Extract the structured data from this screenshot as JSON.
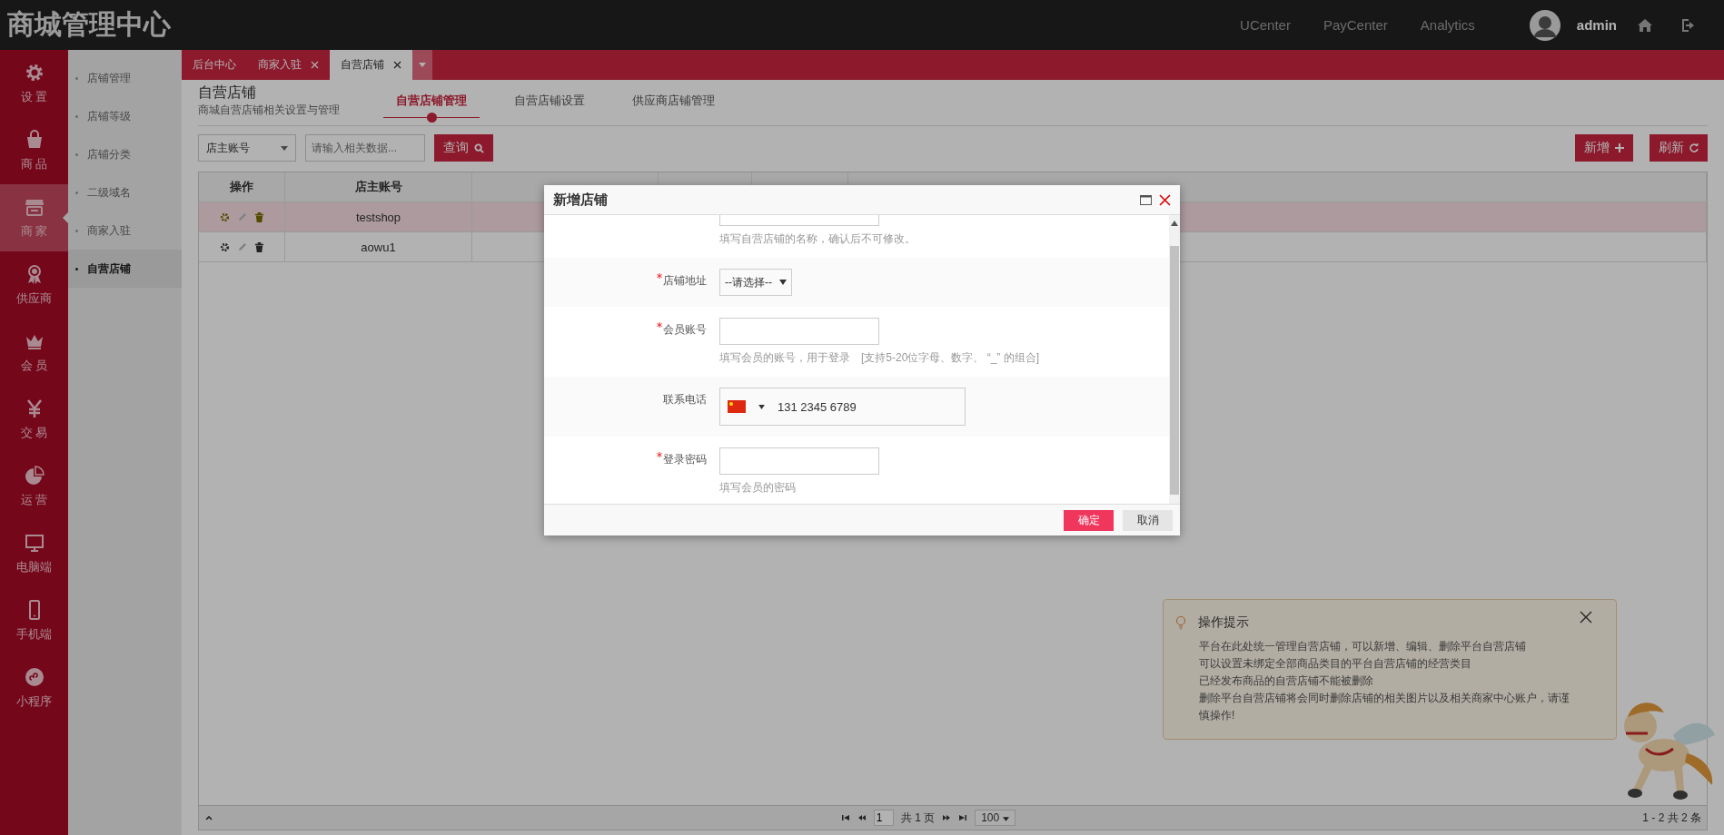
{
  "header": {
    "title": "商城管理中心",
    "links": [
      "UCenter",
      "PayCenter",
      "Analytics"
    ],
    "user": "admin"
  },
  "nav": [
    {
      "label": "设 置",
      "selected": false
    },
    {
      "label": "商 品",
      "selected": false
    },
    {
      "label": "商 家",
      "selected": true
    },
    {
      "label": "供应商",
      "selected": false
    },
    {
      "label": "会 员",
      "selected": false
    },
    {
      "label": "交 易",
      "selected": false
    },
    {
      "label": "运 营",
      "selected": false
    },
    {
      "label": "电脑端",
      "selected": false
    },
    {
      "label": "手机端",
      "selected": false
    },
    {
      "label": "小程序",
      "selected": false
    }
  ],
  "subnav": [
    {
      "label": "店铺管理",
      "selected": false
    },
    {
      "label": "店铺等级",
      "selected": false
    },
    {
      "label": "店铺分类",
      "selected": false
    },
    {
      "label": "二级域名",
      "selected": false
    },
    {
      "label": "商家入驻",
      "selected": false
    },
    {
      "label": "自营店铺",
      "selected": true
    }
  ],
  "tabs": [
    {
      "label": "后台中心",
      "closable": false,
      "selected": false
    },
    {
      "label": "商家入驻",
      "closable": true,
      "selected": false
    },
    {
      "label": "自营店铺",
      "closable": true,
      "selected": true
    }
  ],
  "page": {
    "title": "自营店铺",
    "subtitle": "商城自营店铺相关设置与管理",
    "tabs": [
      {
        "label": "自营店铺管理",
        "selected": true
      },
      {
        "label": "自营店铺设置",
        "selected": false
      },
      {
        "label": "供应商店铺管理",
        "selected": false
      }
    ]
  },
  "search": {
    "field": "店主账号",
    "placeholder": "请输入相关数据...",
    "button": "查询"
  },
  "actions": [
    "新增",
    "刷新"
  ],
  "table": {
    "columns": [
      "操作",
      "店主账号"
    ],
    "rows": [
      {
        "selected": true,
        "account": "testshop"
      },
      {
        "selected": false,
        "account": "aowu1"
      }
    ]
  },
  "pager": {
    "page": "1",
    "total": "共 1 页",
    "size": "100",
    "summary": "1 - 2 共 2 条"
  },
  "dialog": {
    "title": "新增店铺",
    "fields": [
      {
        "kind": "text-cut",
        "hint": "填写自营店铺的名称，确认后不可修改。"
      },
      {
        "kind": "select",
        "label": "店铺地址",
        "required": true,
        "value": "--请选择--"
      },
      {
        "kind": "text",
        "label": "会员账号",
        "required": true,
        "hint": "填写会员的账号，用于登录　[支持5-20位字母、数字、 “_” 的组合]"
      },
      {
        "kind": "phone",
        "label": "联系电话",
        "required": false,
        "value": "131 2345 6789"
      },
      {
        "kind": "text",
        "label": "登录密码",
        "required": true,
        "hint": "填写会员的密码"
      }
    ],
    "buttons": [
      {
        "label": "确定",
        "kind": "primary"
      },
      {
        "label": "取消",
        "kind": "default"
      }
    ]
  },
  "tips": {
    "title": "操作提示",
    "lines": [
      "平台在此处统一管理自营店铺，可以新增、编辑、删除平台自营店铺",
      "可以设置未绑定全部商品类目的平台自营店铺的经营类目",
      "已经发布商品的自营店铺不能被删除",
      "删除平台自营店铺将会同时删除店铺的相关图片以及相关商家中心账户，请谨慎操作!"
    ]
  }
}
